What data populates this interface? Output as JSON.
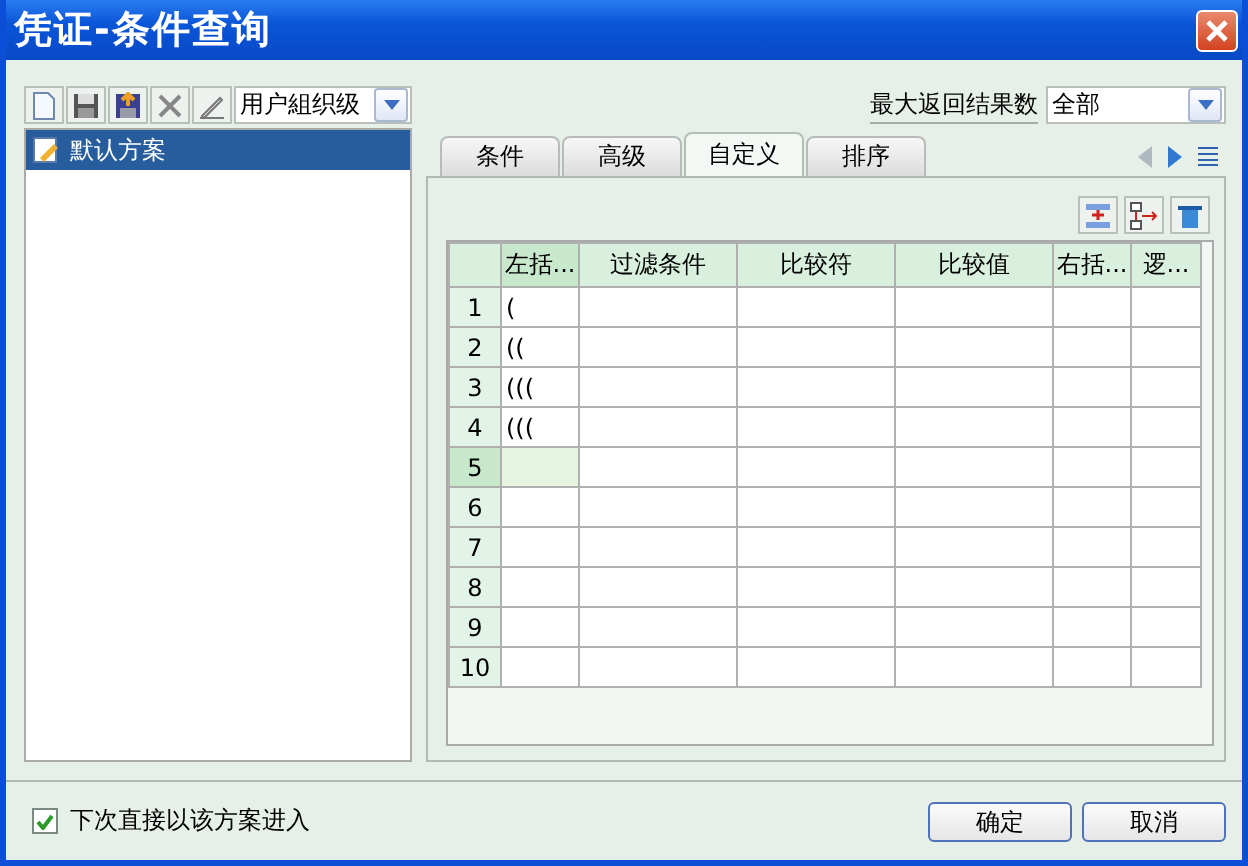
{
  "window": {
    "title": "凭证-条件查询"
  },
  "toolbar": {
    "level_select": {
      "value": "用户組织级"
    }
  },
  "schemes": [
    {
      "label": "默认方案",
      "selected": true
    }
  ],
  "max_results": {
    "label": "最大返回结果数",
    "value": "全部"
  },
  "tabs": [
    {
      "label": "条件",
      "selected": false
    },
    {
      "label": "高级",
      "selected": false
    },
    {
      "label": "自定义",
      "selected": true
    },
    {
      "label": "排序",
      "selected": false
    }
  ],
  "grid": {
    "columns": [
      "左括...",
      "过滤条件",
      "比较符",
      "比较值",
      "右括...",
      "逻..."
    ],
    "rows": [
      {
        "number": "1",
        "left_paren": "(",
        "selected": false
      },
      {
        "number": "2",
        "left_paren": "((",
        "selected": false
      },
      {
        "number": "3",
        "left_paren": "(((",
        "selected": false
      },
      {
        "number": "4",
        "left_paren": "(((",
        "selected": false
      },
      {
        "number": "5",
        "selected": true
      },
      {
        "number": "6",
        "selected": false
      },
      {
        "number": "7",
        "selected": false
      },
      {
        "number": "8",
        "selected": false
      },
      {
        "number": "9",
        "selected": false
      },
      {
        "number": "10",
        "selected": false
      }
    ]
  },
  "footer": {
    "remember": {
      "label": "下次直接以该方案进入",
      "checked": true
    },
    "buttons": [
      "确定",
      "取消"
    ]
  }
}
